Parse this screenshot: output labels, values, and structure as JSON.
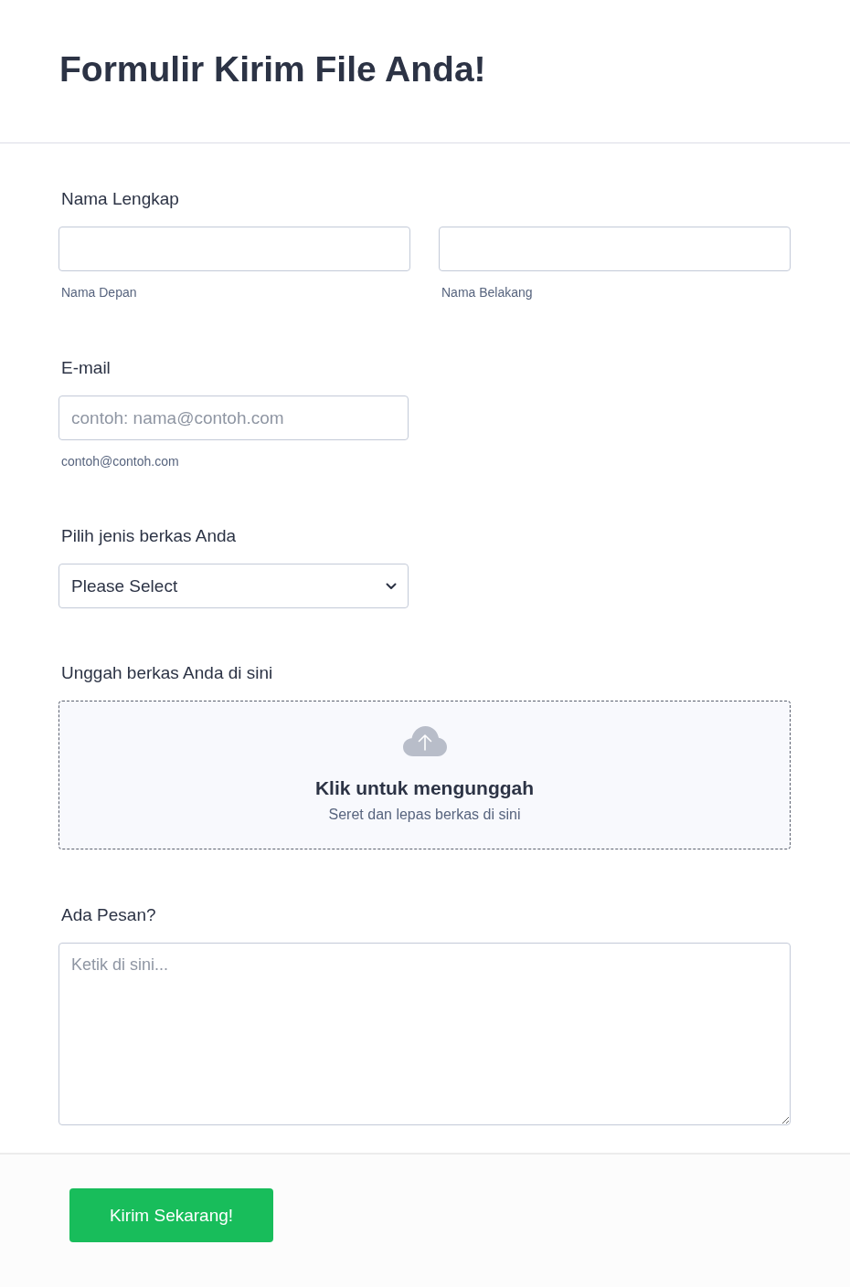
{
  "header": {
    "title": "Formulir Kirim File Anda!"
  },
  "fields": [
    {
      "kind": "name",
      "label": "Nama Lengkap",
      "inputs": [
        {
          "sublabel": "Nama Depan"
        },
        {
          "sublabel": "Nama Belakang"
        }
      ]
    },
    {
      "kind": "email",
      "label": "E-mail",
      "placeholder": "contoh: nama@contoh.com",
      "sublabel": "contoh@contoh.com"
    },
    {
      "kind": "dropdown",
      "label": "Pilih jenis berkas Anda",
      "value": "Please Select"
    },
    {
      "kind": "upload",
      "label": "Unggah berkas Anda di sini",
      "title": "Klik untuk mengunggah",
      "hint": "Seret dan lepas berkas di sini"
    },
    {
      "kind": "textarea",
      "label": "Ada Pesan?",
      "placeholder": "Ketik di sini..."
    }
  ],
  "submit": {
    "label": "Kirim Sekarang!"
  }
}
